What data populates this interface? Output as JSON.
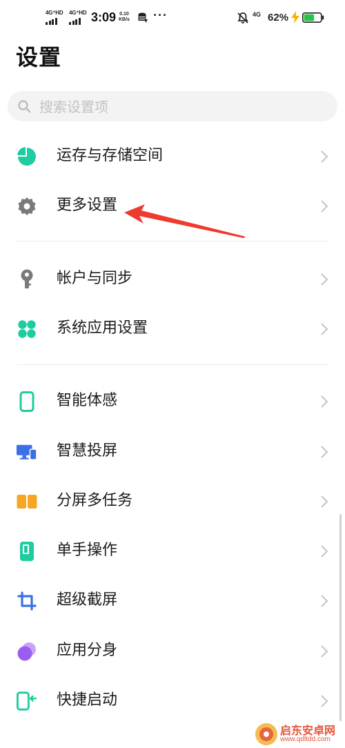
{
  "status_bar": {
    "sim1": "4G⁺HD",
    "sim2": "4G⁺HD",
    "time": "3:09",
    "speed_value": "0.10",
    "speed_unit": "KB/s",
    "more": "···",
    "network": "4G",
    "battery": "62%",
    "battery_level": 0.62
  },
  "title": "设置",
  "search": {
    "placeholder": "搜索设置项"
  },
  "items": [
    {
      "label": "运存与存储空间",
      "icon": "pie-chart-icon"
    },
    {
      "label": "更多设置",
      "icon": "gear-icon"
    },
    {
      "label": "帐户与同步",
      "icon": "key-icon"
    },
    {
      "label": "系统应用设置",
      "icon": "apps-grid-icon"
    },
    {
      "label": "智能体感",
      "icon": "phone-outline-icon"
    },
    {
      "label": "智慧投屏",
      "icon": "cast-screen-icon"
    },
    {
      "label": "分屏多任务",
      "icon": "split-screen-icon"
    },
    {
      "label": "单手操作",
      "icon": "one-hand-icon"
    },
    {
      "label": "超级截屏",
      "icon": "crop-icon"
    },
    {
      "label": "应用分身",
      "icon": "app-clone-icon"
    },
    {
      "label": "快捷启动",
      "icon": "quick-launch-icon"
    }
  ],
  "watermark": {
    "name": "启东安卓网",
    "url": "www.qdltdd.com"
  },
  "colors": {
    "teal": "#1dcc9f",
    "gray_icon": "#7a7a7a",
    "blue": "#3b6fe8",
    "orange": "#f5a623",
    "purple": "#9b5df0",
    "arrow_red": "#ee3a2f",
    "battery_green": "#2bc24a",
    "charge_yellow": "#f7b500"
  }
}
